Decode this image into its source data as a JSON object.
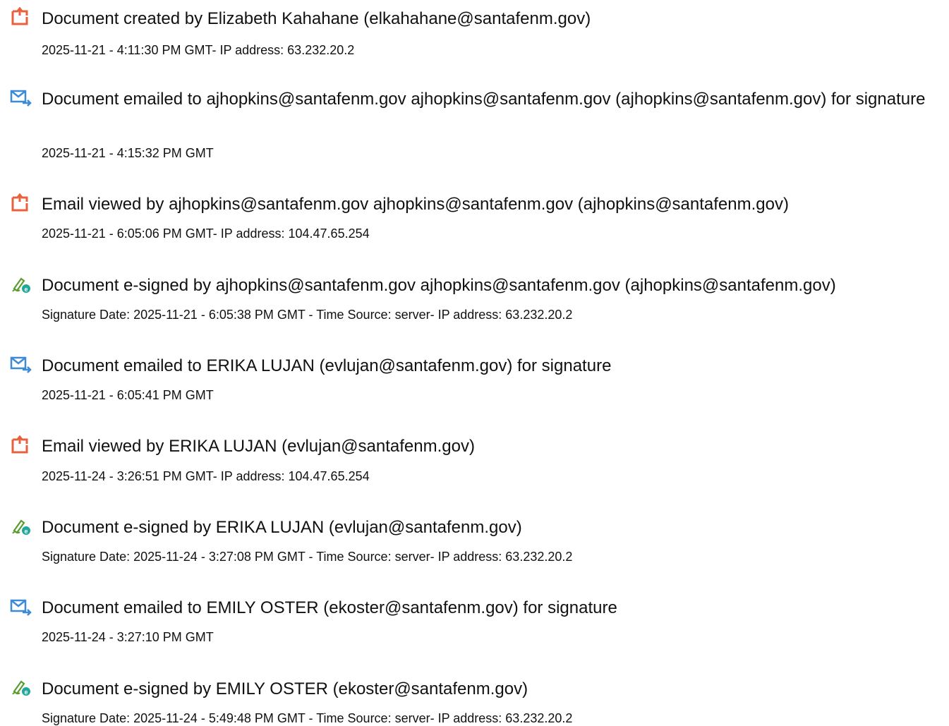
{
  "events": [
    {
      "icon": "document-icon",
      "title": "Document created by Elizabeth Kahahane (elkahahane@santafenm.gov)",
      "detail": "2025-11-21 - 4:11:30 PM GMT- IP address: 63.232.20.2"
    },
    {
      "icon": "email-sent-icon",
      "title": "Document emailed to ajhopkins@santafenm.gov ajhopkins@santafenm.gov (ajhopkins@santafenm.gov) for signature",
      "detail": "2025-11-21 - 4:15:32 PM GMT"
    },
    {
      "icon": "document-icon",
      "title": "Email viewed by ajhopkins@santafenm.gov ajhopkins@santafenm.gov (ajhopkins@santafenm.gov)",
      "detail": "2025-11-21 - 6:05:06 PM GMT- IP address: 104.47.65.254"
    },
    {
      "icon": "e-sign-pen-icon",
      "title": "Document e-signed by ajhopkins@santafenm.gov ajhopkins@santafenm.gov (ajhopkins@santafenm.gov)",
      "detail": "Signature Date: 2025-11-21 - 6:05:38 PM GMT - Time Source: server- IP address: 63.232.20.2"
    },
    {
      "icon": "email-sent-icon",
      "title": "Document emailed to ERIKA LUJAN (evlujan@santafenm.gov) for signature",
      "detail": "2025-11-21 - 6:05:41 PM GMT"
    },
    {
      "icon": "document-icon",
      "title": "Email viewed by ERIKA LUJAN (evlujan@santafenm.gov)",
      "detail": "2025-11-24 - 3:26:51 PM GMT- IP address: 104.47.65.254"
    },
    {
      "icon": "e-sign-pen-icon",
      "title": "Document e-signed by ERIKA LUJAN (evlujan@santafenm.gov)",
      "detail": "Signature Date: 2025-11-24 - 3:27:08 PM GMT - Time Source: server- IP address: 63.232.20.2"
    },
    {
      "icon": "email-sent-icon",
      "title": "Document emailed to EMILY OSTER (ekoster@santafenm.gov) for signature",
      "detail": "2025-11-24 - 3:27:10 PM GMT"
    },
    {
      "icon": "e-sign-pen-icon",
      "title": "Document e-signed by EMILY OSTER (ekoster@santafenm.gov)",
      "detail": "Signature Date: 2025-11-24 - 5:49:48 PM GMT - Time Source: server- IP address: 63.232.20.2"
    }
  ],
  "colors": {
    "document_icon": "#e8613c",
    "email_icon": "#3d8ad6",
    "esign_pen": "#5a9c2e",
    "esign_badge": "#1fa99b",
    "text": "#111111"
  }
}
